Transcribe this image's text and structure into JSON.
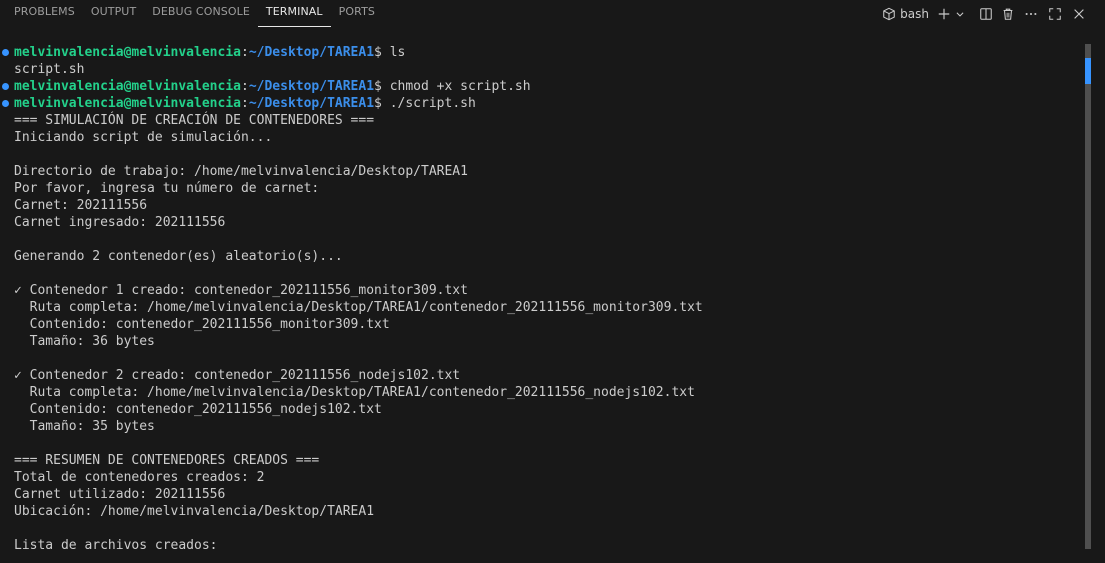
{
  "panel": {
    "tabs": [
      {
        "label": "PROBLEMS"
      },
      {
        "label": "OUTPUT"
      },
      {
        "label": "DEBUG CONSOLE"
      },
      {
        "label": "TERMINAL"
      },
      {
        "label": "PORTS"
      }
    ],
    "active_tab": "TERMINAL",
    "shell": "bash",
    "icons": [
      "terminal-profile-icon",
      "add-icon",
      "chevron-down-icon",
      "split-terminal-icon",
      "trash-icon",
      "more-icon",
      "maximize-icon",
      "close-icon"
    ]
  },
  "terminal": {
    "prompt": {
      "user": "melvinvalencia@melvinvalencia",
      "colon": ":",
      "path": "~/Desktop/TAREA1",
      "suffix": "$ "
    },
    "commands": [
      {
        "cmd": "ls",
        "output": [
          "script.sh"
        ]
      },
      {
        "cmd": "chmod +x script.sh",
        "output": []
      },
      {
        "cmd": "./script.sh",
        "output": [
          "=== SIMULACIÓN DE CREACIÓN DE CONTENEDORES ===",
          "Iniciando script de simulación...",
          "",
          "Directorio de trabajo: /home/melvinvalencia/Desktop/TAREA1",
          "Por favor, ingresa tu número de carnet:",
          "Carnet: 202111556",
          "Carnet ingresado: 202111556",
          "",
          "Generando 2 contenedor(es) aleatorio(s)...",
          "",
          "✓ Contenedor 1 creado: contenedor_202111556_monitor309.txt",
          "  Ruta completa: /home/melvinvalencia/Desktop/TAREA1/contenedor_202111556_monitor309.txt",
          "  Contenido: contenedor_202111556_monitor309.txt",
          "  Tamaño: 36 bytes",
          "",
          "✓ Contenedor 2 creado: contenedor_202111556_nodejs102.txt",
          "  Ruta completa: /home/melvinvalencia/Desktop/TAREA1/contenedor_202111556_nodejs102.txt",
          "  Contenido: contenedor_202111556_nodejs102.txt",
          "  Tamaño: 35 bytes",
          "",
          "=== RESUMEN DE CONTENEDORES CREADOS ===",
          "Total de contenedores creados: 2",
          "Carnet utilizado: 202111556",
          "Ubicación: /home/melvinvalencia/Desktop/TAREA1",
          "",
          "Lista de archivos creados:"
        ]
      }
    ]
  },
  "colors": {
    "background": "#181818",
    "prompt_user": "#23d18b",
    "prompt_path": "#3b8eea",
    "command_dot": "#3794ff",
    "text": "#cccccc"
  }
}
